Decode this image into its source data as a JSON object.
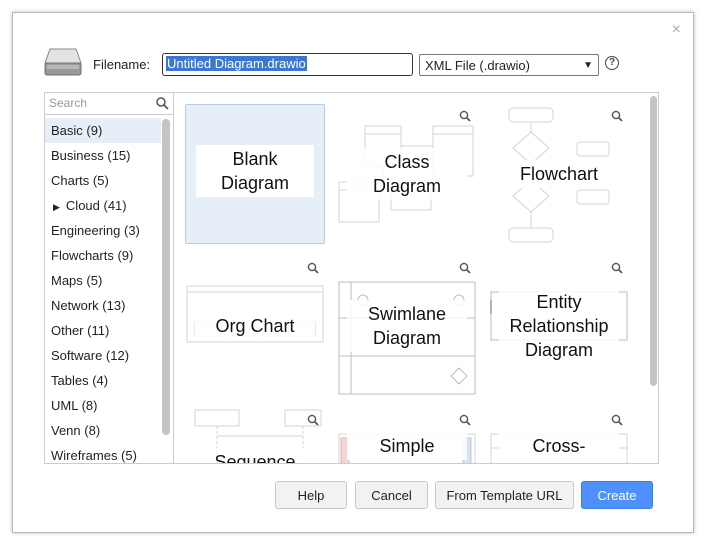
{
  "dialog": {
    "close_symbol": "×",
    "filename_label": "Filename:",
    "filename_value": "Untitled Diagram.drawio",
    "format_selected": "XML File (.drawio)",
    "help_symbol": "?"
  },
  "search": {
    "placeholder": "Search"
  },
  "categories": [
    {
      "label": "Basic (9)"
    },
    {
      "label": "Business (15)"
    },
    {
      "label": "Charts (5)"
    },
    {
      "label": "Cloud (41)"
    },
    {
      "label": "Engineering (3)"
    },
    {
      "label": "Flowcharts (9)"
    },
    {
      "label": "Maps (5)"
    },
    {
      "label": "Network (13)"
    },
    {
      "label": "Other (11)"
    },
    {
      "label": "Software (12)"
    },
    {
      "label": "Tables (4)"
    },
    {
      "label": "UML (8)"
    },
    {
      "label": "Venn (8)"
    },
    {
      "label": "Wireframes (5)"
    }
  ],
  "templates": [
    {
      "line1": "Blank",
      "line2": "Diagram",
      "line3": ""
    },
    {
      "line1": "Class",
      "line2": "Diagram",
      "line3": ""
    },
    {
      "line1": "Flowchart",
      "line2": "",
      "line3": ""
    },
    {
      "line1": "Org Chart",
      "line2": "",
      "line3": ""
    },
    {
      "line1": "Swimlane",
      "line2": "Diagram",
      "line3": ""
    },
    {
      "line1": "Entity",
      "line2": "Relationship",
      "line3": "Diagram"
    },
    {
      "line1": "Sequence",
      "line2": "",
      "line3": ""
    },
    {
      "line1": "Simple",
      "line2": "",
      "line3": ""
    },
    {
      "line1": "Cross-",
      "line2": "",
      "line3": ""
    }
  ],
  "buttons": {
    "help": "Help",
    "cancel": "Cancel",
    "from_template_url": "From Template URL",
    "create": "Create"
  },
  "colors": {
    "accent": "#4d90fe",
    "selection": "#e6eef8"
  }
}
